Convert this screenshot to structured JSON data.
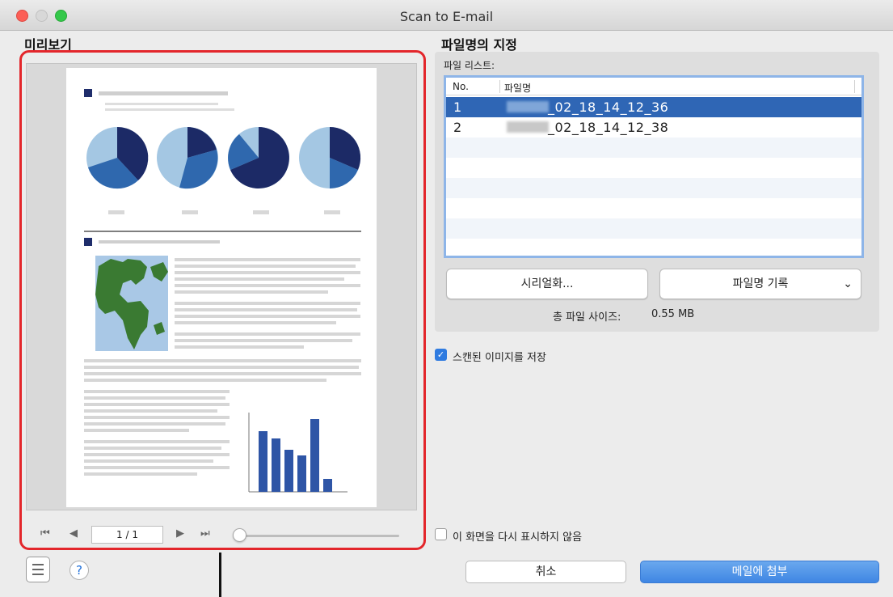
{
  "window": {
    "title": "Scan to E-mail"
  },
  "preview": {
    "label": "미리보기",
    "page_indicator": "1 / 1",
    "zoom_fraction": 0.0
  },
  "filename_section": {
    "label": "파일명의 지정",
    "file_list_label": "파일 리스트:",
    "columns": [
      "No.",
      "파일명"
    ],
    "rows": [
      {
        "no": "1",
        "name": "_02_18_14_12_36",
        "selected": true
      },
      {
        "no": "2",
        "name": "_02_18_14_12_38",
        "selected": false
      }
    ],
    "serialize_button": "시리얼화...",
    "filename_record_select": "파일명 기록",
    "total_size_label": "총 파일 사이즈:",
    "total_size_value": "0.55  MB"
  },
  "options": {
    "save_scanned_image": {
      "label": "스캔된 이미지를 저장",
      "checked": true
    },
    "dont_show_again": {
      "label": "이 화면을 다시 표시하지 않음",
      "checked": false
    }
  },
  "buttons": {
    "cancel": "취소",
    "attach": "메일에 첨부"
  },
  "colors": {
    "highlight_frame": "#e3262b",
    "selection": "#2f66b5",
    "primary_button": "#4a8fe7"
  }
}
